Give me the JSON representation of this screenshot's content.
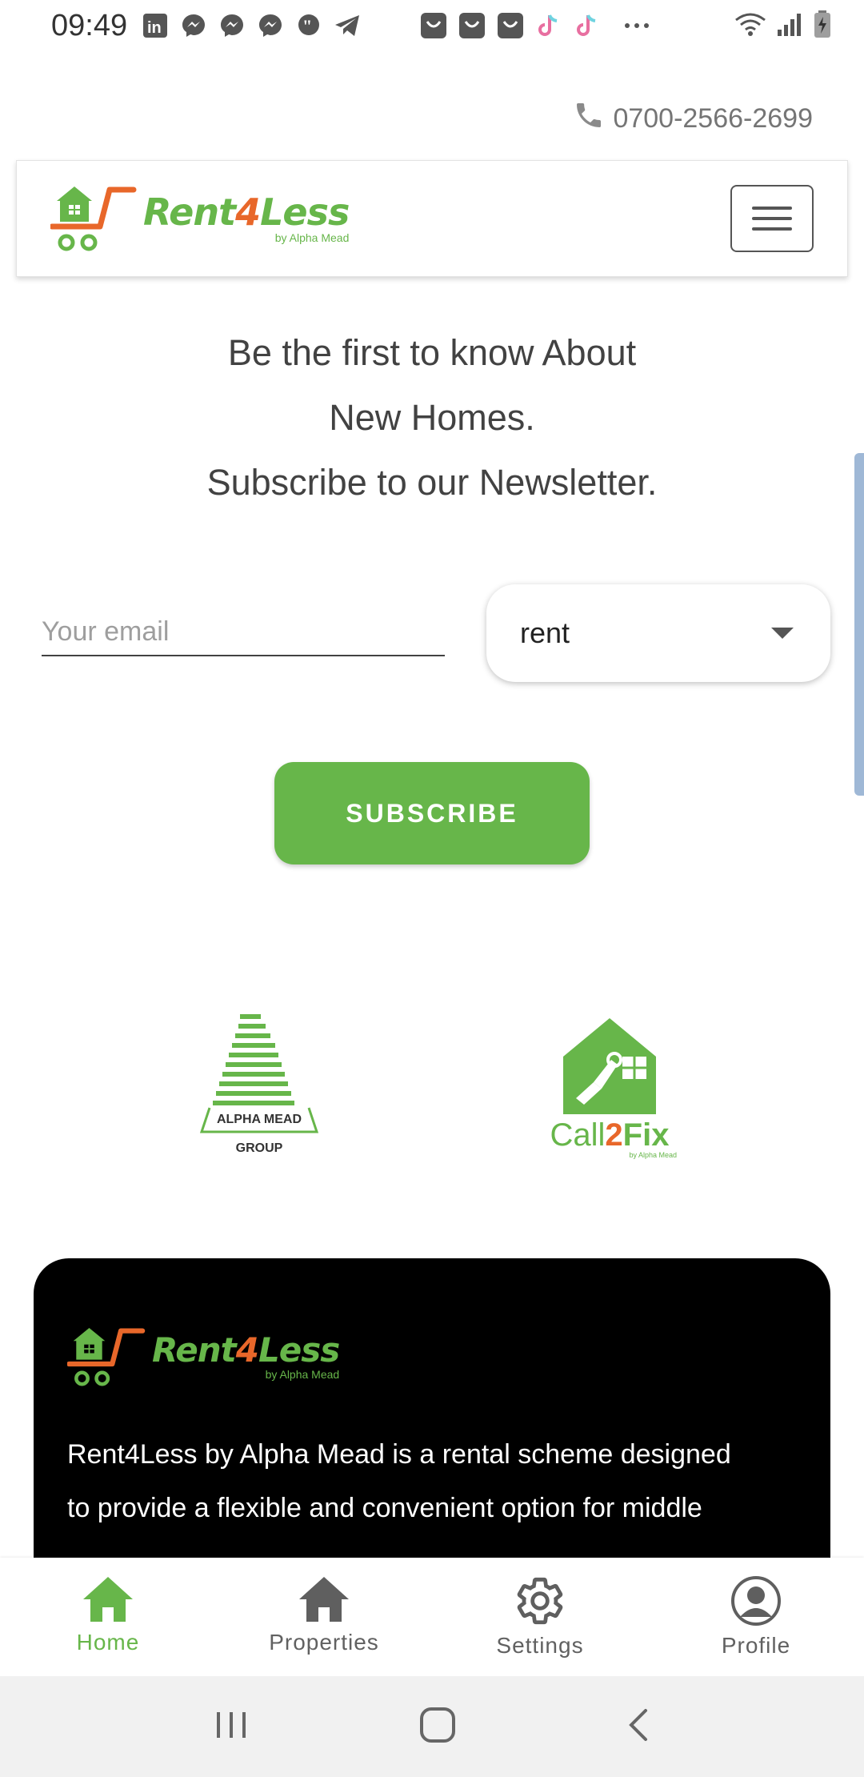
{
  "status_bar": {
    "time": "09:49",
    "left_icons": [
      "linkedin-icon",
      "messenger-icon",
      "messenger-icon",
      "messenger-icon",
      "quote-icon",
      "telegram-icon",
      "shop-icon",
      "shop-icon",
      "shop-icon",
      "tiktok-icon",
      "tiktok-icon",
      "more-icon"
    ],
    "right_icons": [
      "wifi-icon",
      "signal-icon",
      "battery-icon"
    ]
  },
  "contact": {
    "phone": "0700-2566-2699"
  },
  "header": {
    "logo_main": "Rent",
    "logo_four": "4",
    "logo_rest": "Less",
    "logo_sub": "by Alpha Mead"
  },
  "newsletter": {
    "line1": "Be the first to know About",
    "line2": "New Homes.",
    "line3": "Subscribe to our Newsletter.",
    "email_placeholder": "Your email",
    "email_value": "",
    "select_value": "rent",
    "subscribe_label": "SUBSCRIBE"
  },
  "partners": {
    "alpha_mead_line1": "ALPHA MEAD",
    "alpha_mead_line2": "GROUP",
    "call2fix_a": "Call",
    "call2fix_b": "2",
    "call2fix_c": "Fix",
    "call2fix_sub": "by Alpha Mead"
  },
  "footer": {
    "logo_main": "Rent",
    "logo_four": "4",
    "logo_rest": "Less",
    "logo_sub": "by Alpha Mead",
    "description_line1": "Rent4Less by Alpha Mead is a rental scheme designed",
    "description_line2": "to provide a flexible and convenient option for middle"
  },
  "bottom_nav": {
    "items": [
      {
        "label": "Home",
        "icon": "home-icon",
        "active": true
      },
      {
        "label": "Properties",
        "icon": "house-icon",
        "active": false
      },
      {
        "label": "Settings",
        "icon": "gear-icon",
        "active": false
      },
      {
        "label": "Profile",
        "icon": "profile-icon",
        "active": false
      }
    ]
  },
  "colors": {
    "brand_green": "#67b64a",
    "brand_orange": "#e8672a",
    "footer_bg": "#000000"
  }
}
